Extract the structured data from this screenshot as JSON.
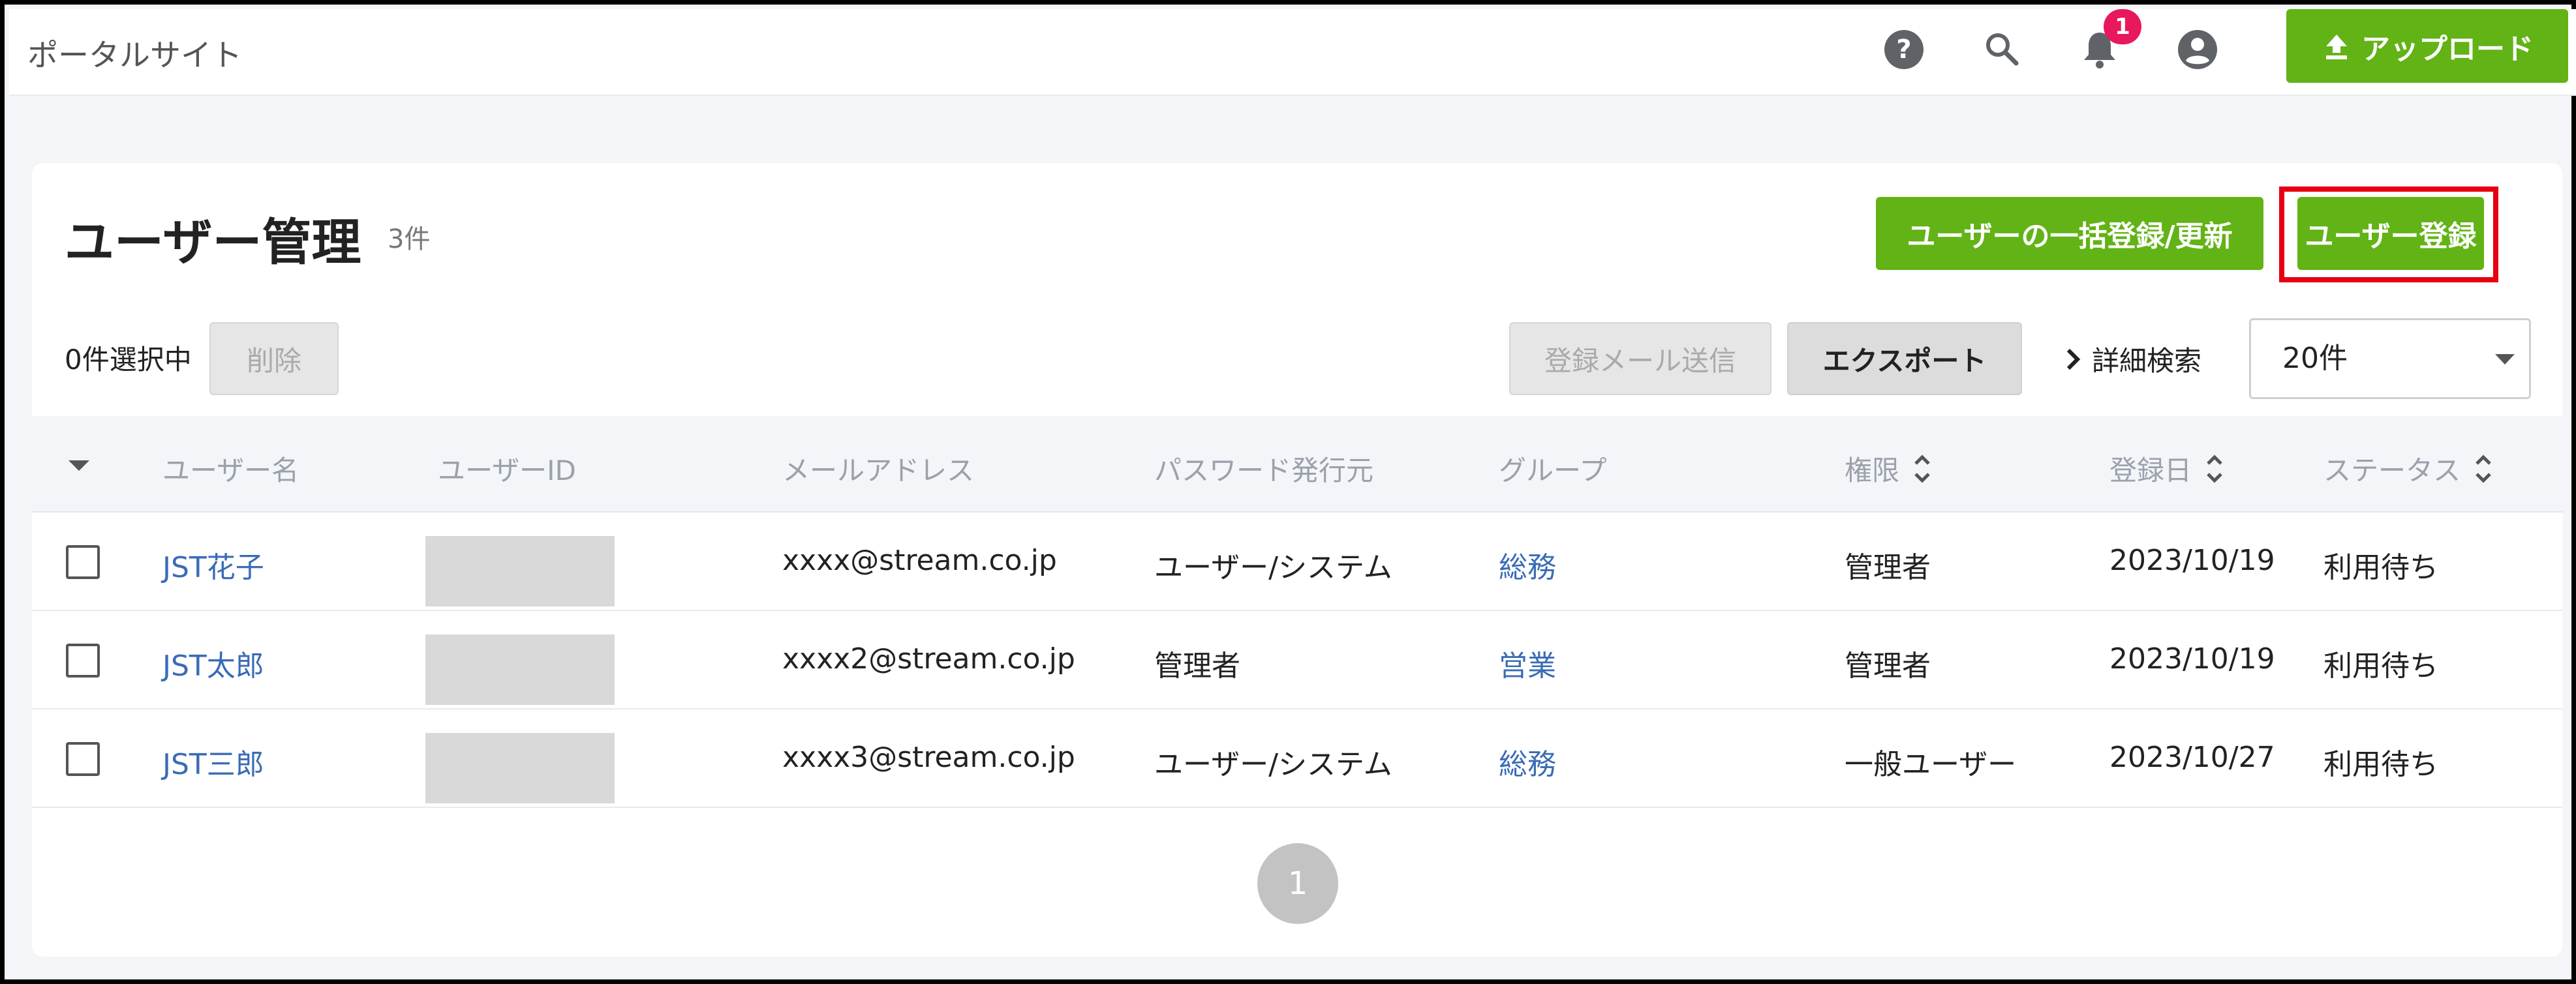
{
  "header": {
    "site_title": "ポータルサイト",
    "notification_count": "1",
    "upload_label": "アップロード",
    "icons": [
      "help-icon",
      "search-icon",
      "bell-icon",
      "account-icon",
      "upload-icon"
    ]
  },
  "page": {
    "title": "ユーザー管理",
    "count": "3件",
    "bulk_register_label": "ユーザーの一括登録/更新",
    "register_label": "ユーザー登録"
  },
  "toolbar": {
    "selected_count": "0件選択中",
    "delete_label": "削除",
    "send_mail_label": "登録メール送信",
    "export_label": "エクスポート",
    "advanced_search_label": "詳細検索",
    "page_size": "20件"
  },
  "table": {
    "columns": [
      "ユーザー名",
      "ユーザーID",
      "メールアドレス",
      "パスワード発行元",
      "グループ",
      "権限",
      "登録日",
      "ステータス"
    ],
    "rows": [
      {
        "name": "JST花子",
        "email": "xxxx@stream.co.jp",
        "password_source": "ユーザー/システム",
        "group": "総務",
        "role": "管理者",
        "registered": "2023/10/19",
        "status": "利用待ち"
      },
      {
        "name": "JST太郎",
        "email": "xxxx2@stream.co.jp",
        "password_source": "管理者",
        "group": "営業",
        "role": "管理者",
        "registered": "2023/10/19",
        "status": "利用待ち"
      },
      {
        "name": "JST三郎",
        "email": "xxxx3@stream.co.jp",
        "password_source": "ユーザー/システム",
        "group": "総務",
        "role": "一般ユーザー",
        "registered": "2023/10/27",
        "status": "利用待ち"
      }
    ]
  },
  "pagination": {
    "current_page": "1"
  },
  "colors": {
    "accent_green": "#62b316",
    "highlight_red": "#e60012",
    "link_blue": "#3a6cb5",
    "badge_pink": "#e8185c"
  }
}
